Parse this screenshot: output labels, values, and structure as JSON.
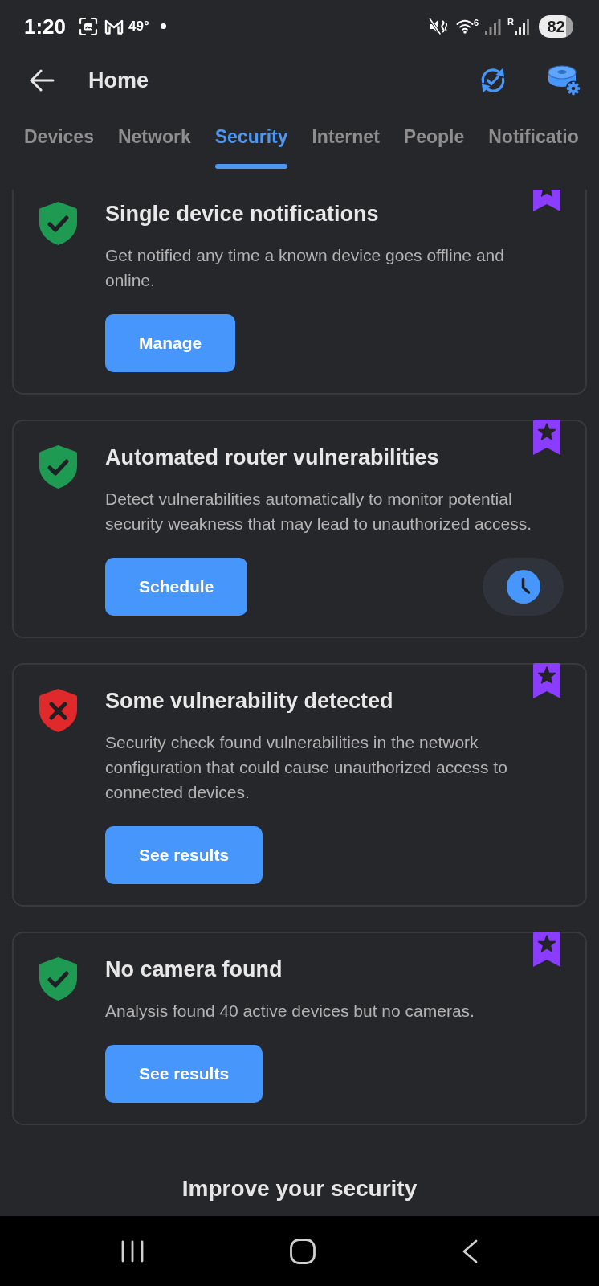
{
  "status_bar": {
    "time": "1:20",
    "temperature": "49°",
    "wifi_label": "6",
    "network_label": "R",
    "battery": "82"
  },
  "header": {
    "title": "Home"
  },
  "tabs": [
    {
      "label": "Devices",
      "selected": false
    },
    {
      "label": "Network",
      "selected": false
    },
    {
      "label": "Security",
      "selected": true
    },
    {
      "label": "Internet",
      "selected": false
    },
    {
      "label": "People",
      "selected": false
    },
    {
      "label": "Notificatio",
      "selected": false
    }
  ],
  "cards": [
    {
      "passed": true,
      "title": "Single device notifications",
      "description": "Get notified any time a known device goes offline and online.",
      "button": "Manage",
      "timer_button": false
    },
    {
      "passed": true,
      "title": "Automated router vulnerabilities",
      "description": "Detect vulnerabilities automatically to monitor potential security weakness that may lead to unauthorized access.",
      "button": "Schedule",
      "timer_button": true
    },
    {
      "passed": false,
      "title": "Some vulnerability detected",
      "description": "Security check found vulnerabilities in the network configuration that could cause unauthorized access to connected devices.",
      "button": "See results",
      "timer_button": false
    },
    {
      "passed": true,
      "title": "No camera found",
      "description": "Analysis found 40 active devices but no cameras.",
      "button": "See results",
      "timer_button": false
    }
  ],
  "section_heading": "Improve your security"
}
